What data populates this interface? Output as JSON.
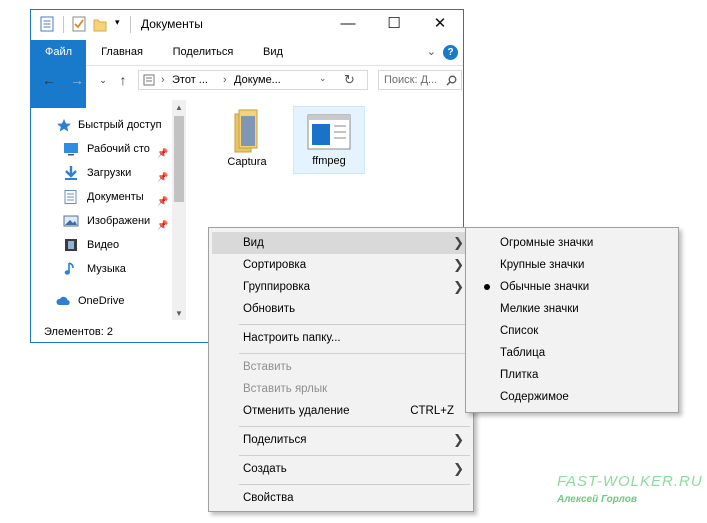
{
  "window": {
    "title": "Документы",
    "controls": {
      "minimize": "—",
      "maximize": "☐",
      "close": "✕"
    }
  },
  "ribbon": {
    "tabs": [
      "Файл",
      "Главная",
      "Поделиться",
      "Вид"
    ],
    "help": "?"
  },
  "address": {
    "crumbs": [
      "Этот ...",
      "Докуме..."
    ],
    "search_placeholder": "Поиск: Д..."
  },
  "nav": {
    "items": [
      {
        "label": "Быстрый доступ",
        "icon": "star-icon"
      },
      {
        "label": "Рабочий сто",
        "icon": "desktop-icon",
        "pinned": true
      },
      {
        "label": "Загрузки",
        "icon": "download-icon",
        "pinned": true
      },
      {
        "label": "Документы",
        "icon": "documents-icon",
        "pinned": true
      },
      {
        "label": "Изображени",
        "icon": "pictures-icon",
        "pinned": true
      },
      {
        "label": "Видео",
        "icon": "video-icon"
      },
      {
        "label": "Музыка",
        "icon": "music-icon"
      },
      {
        "label": "OneDrive",
        "icon": "cloud-icon"
      }
    ]
  },
  "files": [
    {
      "name": "Captura",
      "icon": "folder-icon"
    },
    {
      "name": "ffmpeg",
      "icon": "folder-icon",
      "selected": true
    }
  ],
  "status": "Элементов: 2",
  "context_menu": {
    "items": [
      {
        "label": "Вид",
        "submenu": true,
        "highlighted": true
      },
      {
        "label": "Сортировка",
        "submenu": true
      },
      {
        "label": "Группировка",
        "submenu": true
      },
      {
        "label": "Обновить"
      },
      {
        "label": "Настроить папку..."
      },
      {
        "label": "Вставить",
        "disabled": true
      },
      {
        "label": "Вставить ярлык",
        "disabled": true
      },
      {
        "label": "Отменить удаление",
        "shortcut": "CTRL+Z"
      },
      {
        "label": "Поделиться",
        "submenu": true
      },
      {
        "label": "Создать",
        "submenu": true
      },
      {
        "label": "Свойства"
      }
    ]
  },
  "view_submenu": {
    "items": [
      "Огромные значки",
      "Крупные значки",
      "Обычные значки",
      "Мелкие значки",
      "Список",
      "Таблица",
      "Плитка",
      "Содержимое"
    ],
    "selected": "Обычные значки"
  },
  "watermark": {
    "site": "FAST-WOLKER.RU",
    "author": "Алексей Горлов"
  },
  "colors": {
    "accent": "#1979ca",
    "folder": "#f5d37a",
    "menu_bg": "#f2f2f2"
  }
}
